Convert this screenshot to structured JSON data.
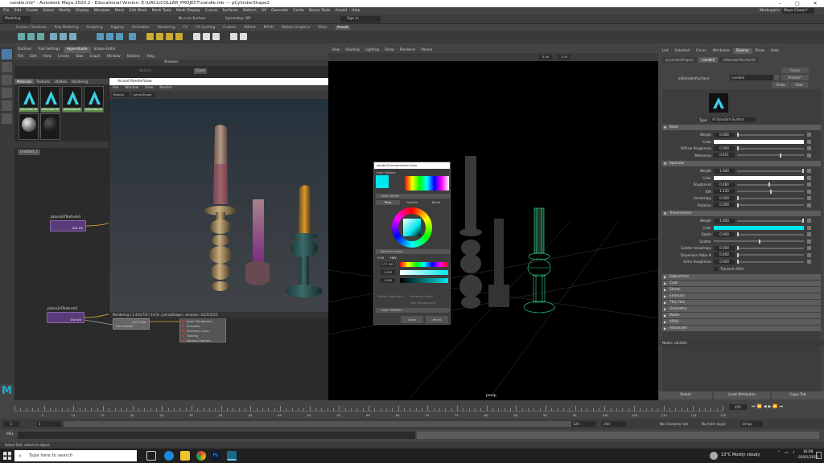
{
  "window": {
    "title": "candle.mb* - Autodesk Maya 2020.2 - Educational Version: E:\\UACL\\COLLAR_PROJECT\\candle.mb  ---  pCylinderShape2",
    "workspace_label": "Workspace:",
    "workspace": "Maya Classic*"
  },
  "menubar": [
    "File",
    "Edit",
    "Create",
    "Select",
    "Modify",
    "Display",
    "Windows",
    "Mesh",
    "Edit Mesh",
    "Mesh Tools",
    "Mesh Display",
    "Curves",
    "Surfaces",
    "Deform",
    "UV",
    "Generate",
    "Cache",
    "Bonus Tools",
    "Arnold",
    "Help"
  ],
  "statusline": {
    "mode": "Modeling",
    "live_surface": "No Live Surface",
    "symmetry": "Symmetry: Off",
    "sign_in": "Sign In"
  },
  "shelf_tabs": [
    "Curves / Surfaces",
    "Poly Modeling",
    "Sculpting",
    "Rigging",
    "Animation",
    "Rendering",
    "FX",
    "FX Caching",
    "Custom",
    "Bifrost",
    "MASH",
    "Motion Graphics",
    "XGen",
    "Arnold"
  ],
  "hypershade": {
    "tabs": [
      "Outliner",
      "Tool Settings",
      "Hypershade",
      "Shape Editor"
    ],
    "menu": [
      "File",
      "Edit",
      "View",
      "Create",
      "Tabs",
      "Graph",
      "Window",
      "Options",
      "Help"
    ],
    "browser_label": "Browser",
    "search_placeholder": "Search...",
    "close": "Close",
    "browser_tabs": [
      "Materials",
      "Textures",
      "Utilities",
      "Rendering"
    ],
    "materials": [
      "aiStandardS",
      "aiStandardS",
      "aiStandardS",
      "aiStandardS"
    ],
    "untitled_tab": "Untitled_1",
    "node1": {
      "title": "place2dTexture4",
      "port": "Out UV"
    },
    "node2": {
      "title": "place2dTexture5",
      "port": "Out UV"
    },
    "node3": {
      "title": "Checker1",
      "ports": [
        "Out Color",
        "File Exwest"
      ]
    },
    "node4_ports": [
      "Specl Roughness",
      "Emission",
      "Emission Color",
      "Opacity",
      "Normal Camera"
    ]
  },
  "renderview": {
    "title": "Arnold RenderView",
    "menu": [
      "File",
      "Window",
      "View",
      "Render"
    ],
    "camera": "Beauty",
    "shape": "perspShape",
    "status": "Rendering | 1.43s/72f | 14 f/s | perspShape | samples: 3/2/2/2/2/2"
  },
  "viewport": {
    "menu": [
      "View",
      "Shading",
      "Lighting",
      "Show",
      "Renderer",
      "Panels"
    ],
    "camera_label": "persp",
    "field1": "0.00",
    "field2": "1.00"
  },
  "colorpicker": {
    "title": "candle2.transmissionColor",
    "history": "Color History",
    "wheel": "Color Wheel",
    "tabs": [
      "Ring",
      "Hue/Sat",
      "Blend"
    ],
    "numeric": "Numeric Input",
    "modes": [
      "RGB",
      "HSV"
    ],
    "h": "177.201",
    "s": "1.000",
    "v": "1.000",
    "display_label": "Mixing Color Space",
    "display_value": "Rendering Space",
    "color_manage": "Color Management",
    "palettes": "Color Palettes",
    "done": "Done",
    "reset": "Reset"
  },
  "attr": {
    "tabs": [
      "List",
      "Selected",
      "Focus",
      "Attributes",
      "Display",
      "Show",
      "Help"
    ],
    "node_tabs": [
      "pCylinderShape2",
      "candle2",
      "aiStandardSurface6"
    ],
    "shader_label": "aiStandardSurface:",
    "shader_name": "candle2",
    "focus": "Focus",
    "presets": "Presets*",
    "show": "Show",
    "hide": "Hide",
    "type_label": "Type",
    "type_value": "AI Standard Surface",
    "sections": {
      "base": "Base",
      "specular": "Specular",
      "transmission": "Transmission",
      "collapsed": [
        "Subsurface",
        "Coat",
        "Sheen",
        "Emission",
        "Thin Film",
        "Geometry",
        "Matte",
        "AOVs",
        "Advanced"
      ]
    },
    "base": [
      {
        "label": "Weight",
        "value": "0.000"
      },
      {
        "label": "Color",
        "value": ""
      },
      {
        "label": "Diffuse Roughness",
        "value": "0.000"
      },
      {
        "label": "Metalness",
        "value": "0.651"
      }
    ],
    "specular": [
      {
        "label": "Weight",
        "value": "1.000"
      },
      {
        "label": "Color",
        "value": ""
      },
      {
        "label": "Roughness",
        "value": "0.480"
      },
      {
        "label": "IOR",
        "value": "1.520"
      },
      {
        "label": "Anisotropy",
        "value": "0.000"
      },
      {
        "label": "Rotation",
        "value": "0.000"
      }
    ],
    "transmission": [
      {
        "label": "Weight",
        "value": "1.000"
      },
      {
        "label": "Color",
        "value": ""
      },
      {
        "label": "Depth",
        "value": "0.000"
      },
      {
        "label": "Scatter",
        "value": ""
      },
      {
        "label": "Scatter Anisotropy",
        "value": "0.000"
      },
      {
        "label": "Dispersion Abbe #",
        "value": "0.000"
      },
      {
        "label": "Extra Roughness",
        "value": "0.000"
      }
    ],
    "transmit_aovs": "Transmit AOVs",
    "notes": "Notes: candle2",
    "buttons": [
      "Select",
      "Load Attributes",
      "Copy Tab"
    ]
  },
  "colors": {
    "base_color": "#ffffff",
    "spec_color": "#ffffff",
    "trans_color": "#00e8ee"
  },
  "timeline": {
    "ticks": [
      "5",
      "10",
      "15",
      "20",
      "25",
      "30",
      "35",
      "40",
      "45",
      "50",
      "55",
      "60",
      "65",
      "70",
      "75",
      "80",
      "85",
      "90",
      "95",
      "100",
      "105",
      "110",
      "115",
      "120"
    ],
    "current": "450"
  },
  "range": {
    "start": "1",
    "start2": "1",
    "playstart": "1",
    "end": "120",
    "end2": "120",
    "anim_end": "200",
    "char_set": "No Character Set",
    "anim_layer": "No Anim Layer",
    "fps": "24 fps"
  },
  "cmd": {
    "label": "MEL"
  },
  "help": "Select Tool: select an object",
  "taskbar": {
    "search": "Type here to search",
    "weather": "13°C  Mostly cloudy",
    "time": "16:08",
    "date": "03/01/2022"
  }
}
